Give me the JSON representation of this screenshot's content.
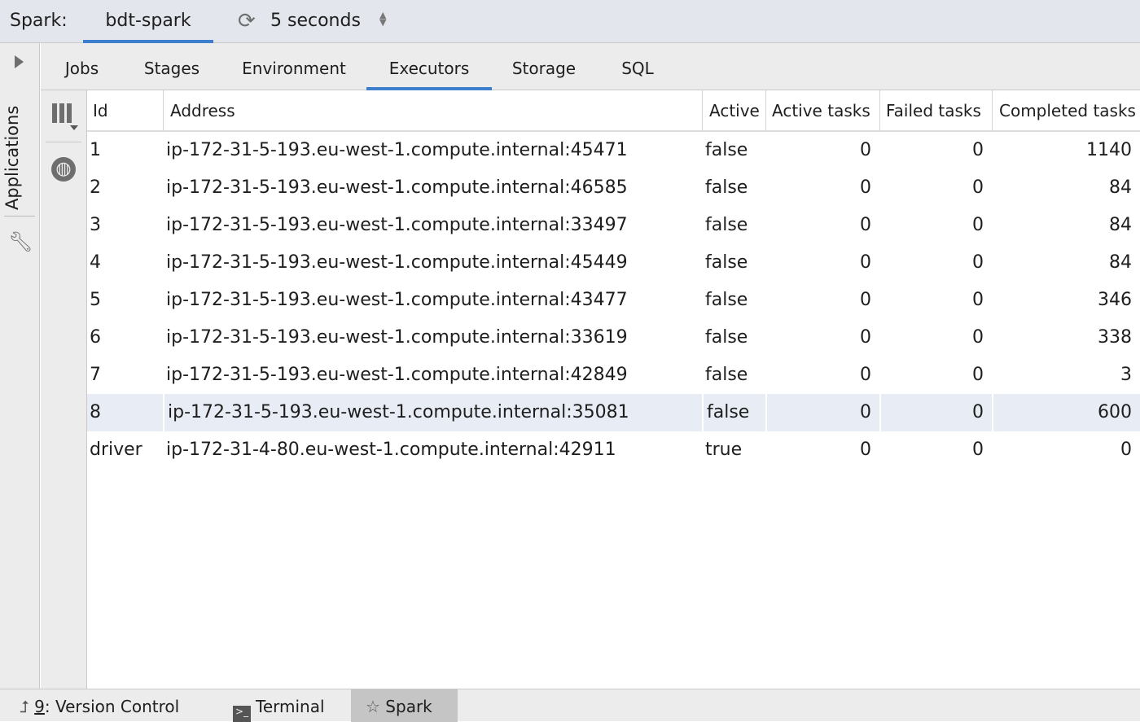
{
  "topbar": {
    "label": "Spark:",
    "connection": "bdt-spark",
    "refresh_icon": "refresh-icon",
    "interval": "5 seconds"
  },
  "sidebar": {
    "applications_label": "Applications"
  },
  "tabs": [
    {
      "label": "Jobs"
    },
    {
      "label": "Stages"
    },
    {
      "label": "Environment"
    },
    {
      "label": "Executors",
      "selected": true
    },
    {
      "label": "Storage"
    },
    {
      "label": "SQL"
    }
  ],
  "table": {
    "columns": [
      "Id",
      "Address",
      "Active",
      "Active tasks",
      "Failed tasks",
      "Completed tasks"
    ],
    "rows": [
      {
        "id": "1",
        "address": "ip-172-31-5-193.eu-west-1.compute.internal:45471",
        "active": "false",
        "active_tasks": "0",
        "failed_tasks": "0",
        "completed_tasks": "1140"
      },
      {
        "id": "2",
        "address": "ip-172-31-5-193.eu-west-1.compute.internal:46585",
        "active": "false",
        "active_tasks": "0",
        "failed_tasks": "0",
        "completed_tasks": "84"
      },
      {
        "id": "3",
        "address": "ip-172-31-5-193.eu-west-1.compute.internal:33497",
        "active": "false",
        "active_tasks": "0",
        "failed_tasks": "0",
        "completed_tasks": "84"
      },
      {
        "id": "4",
        "address": "ip-172-31-5-193.eu-west-1.compute.internal:45449",
        "active": "false",
        "active_tasks": "0",
        "failed_tasks": "0",
        "completed_tasks": "84"
      },
      {
        "id": "5",
        "address": "ip-172-31-5-193.eu-west-1.compute.internal:43477",
        "active": "false",
        "active_tasks": "0",
        "failed_tasks": "0",
        "completed_tasks": "346"
      },
      {
        "id": "6",
        "address": "ip-172-31-5-193.eu-west-1.compute.internal:33619",
        "active": "false",
        "active_tasks": "0",
        "failed_tasks": "0",
        "completed_tasks": "338"
      },
      {
        "id": "7",
        "address": "ip-172-31-5-193.eu-west-1.compute.internal:42849",
        "active": "false",
        "active_tasks": "0",
        "failed_tasks": "0",
        "completed_tasks": "3"
      },
      {
        "id": "8",
        "address": "ip-172-31-5-193.eu-west-1.compute.internal:35081",
        "active": "false",
        "active_tasks": "0",
        "failed_tasks": "0",
        "completed_tasks": "600",
        "selected": true
      },
      {
        "id": "driver",
        "address": "ip-172-31-4-80.eu-west-1.compute.internal:42911",
        "active": "true",
        "active_tasks": "0",
        "failed_tasks": "0",
        "completed_tasks": "0"
      }
    ]
  },
  "bottombar": [
    {
      "mnemonic": "9",
      "label": ": Version Control"
    },
    {
      "label": "Terminal"
    },
    {
      "label": "Spark",
      "active": true
    }
  ],
  "colors": {
    "accent": "#3d7fcc",
    "selection": "#e8edf5"
  }
}
